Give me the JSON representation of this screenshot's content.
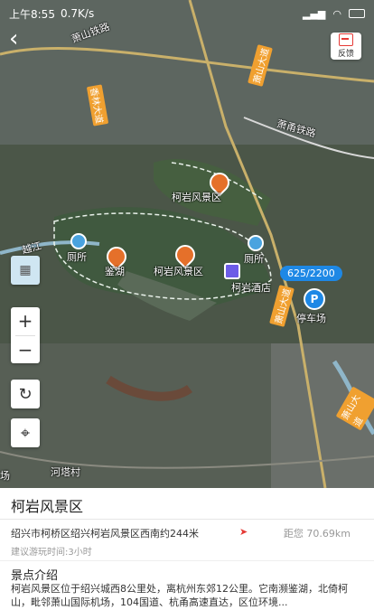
{
  "status_bar": {
    "time": "上午8:55",
    "network_speed": "0.7K/s",
    "battery_icon": "battery-icon"
  },
  "map": {
    "feedback_label": "反馈",
    "zoom_in": "+",
    "zoom_out": "−",
    "distance_chip": "625/2200",
    "labels": {
      "road_top": "萧山铁路",
      "road_right_top": "萧山大道",
      "road_east": "萧甬铁路",
      "xianglin": "香林大道",
      "scenic_a": "柯岩风景区",
      "scenic_b": "柯岩风景区",
      "lianhu": "鉴湖",
      "toilet_left": "厕所",
      "toilet_right": "厕所",
      "hotel": "柯岩酒店",
      "parking": "停车场",
      "yuanjiang": "越江",
      "village": "河塔村",
      "chang": "场"
    },
    "road_badges": [
      "萧山大道",
      "萧山大道"
    ]
  },
  "panel": {
    "title": "柯岩风景区",
    "address": "绍兴市柯桥区绍兴柯岩风景区西南约244米",
    "distance": "距您 70.69km",
    "suggested_time": "建议游玩时间:3小时",
    "intro_heading": "景点介绍",
    "intro_text": "柯岩风景区位于绍兴城西8公里处，离杭州东郊12公里。它南濒鉴湖，北倚柯山，毗邻萧山国际机场，104国道、杭甬高速直达，区位环境..."
  }
}
